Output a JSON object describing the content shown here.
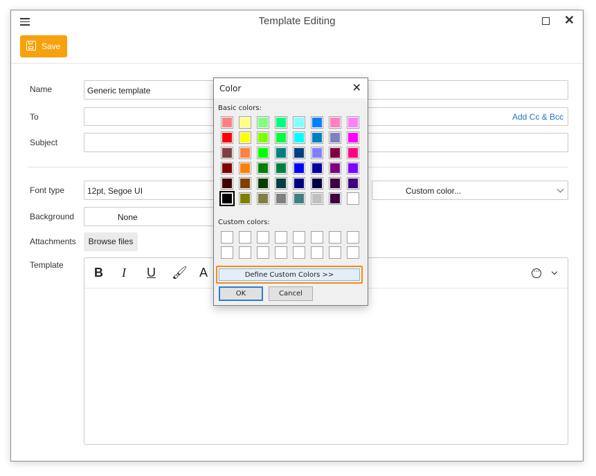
{
  "window": {
    "title": "Template Editing"
  },
  "toolbar": {
    "save_label": "Save"
  },
  "form": {
    "name_label": "Name",
    "name_value": "Generic template",
    "to_label": "To",
    "add_cc_label": "Add Cc & Bcc",
    "subject_label": "Subject",
    "font_type_label": "Font type",
    "font_type_value": "12pt, Segoe UI",
    "custom_color_value": "Custom color...",
    "background_label": "Background",
    "background_value": "None",
    "attachments_label": "Attachments",
    "browse_label": "Browse files",
    "template_label": "Template"
  },
  "editor_toolbar": {
    "bold": "B",
    "italic": "I",
    "underline": "U",
    "font_color": "A"
  },
  "color_dialog": {
    "title": "Color",
    "basic_label": "Basic colors:",
    "custom_label": "Custom colors:",
    "define_label": "Define Custom Colors >>",
    "ok_label": "OK",
    "cancel_label": "Cancel",
    "basic_colors": [
      [
        "#ff8080",
        "#ffff80",
        "#80ff80",
        "#00ff80",
        "#80ffff",
        "#0080ff",
        "#ff80c0",
        "#ff80ff"
      ],
      [
        "#ff0000",
        "#ffff00",
        "#80ff00",
        "#00ff40",
        "#00ffff",
        "#0080c0",
        "#8080c0",
        "#ff00ff"
      ],
      [
        "#804040",
        "#ff8040",
        "#00ff00",
        "#008080",
        "#004080",
        "#8080ff",
        "#800040",
        "#ff0080"
      ],
      [
        "#800000",
        "#ff8000",
        "#008000",
        "#008040",
        "#0000ff",
        "#0000a0",
        "#800080",
        "#8000ff"
      ],
      [
        "#400000",
        "#804000",
        "#004000",
        "#004040",
        "#000080",
        "#000040",
        "#400040",
        "#400080"
      ],
      [
        "#000000",
        "#808000",
        "#808040",
        "#808080",
        "#408080",
        "#c0c0c0",
        "#400040",
        "#ffffff"
      ]
    ],
    "selected": "#000000"
  },
  "accent_colors": {
    "save": "#f7a20c",
    "link": "#1e74d0",
    "focus": "#f08c1e"
  }
}
